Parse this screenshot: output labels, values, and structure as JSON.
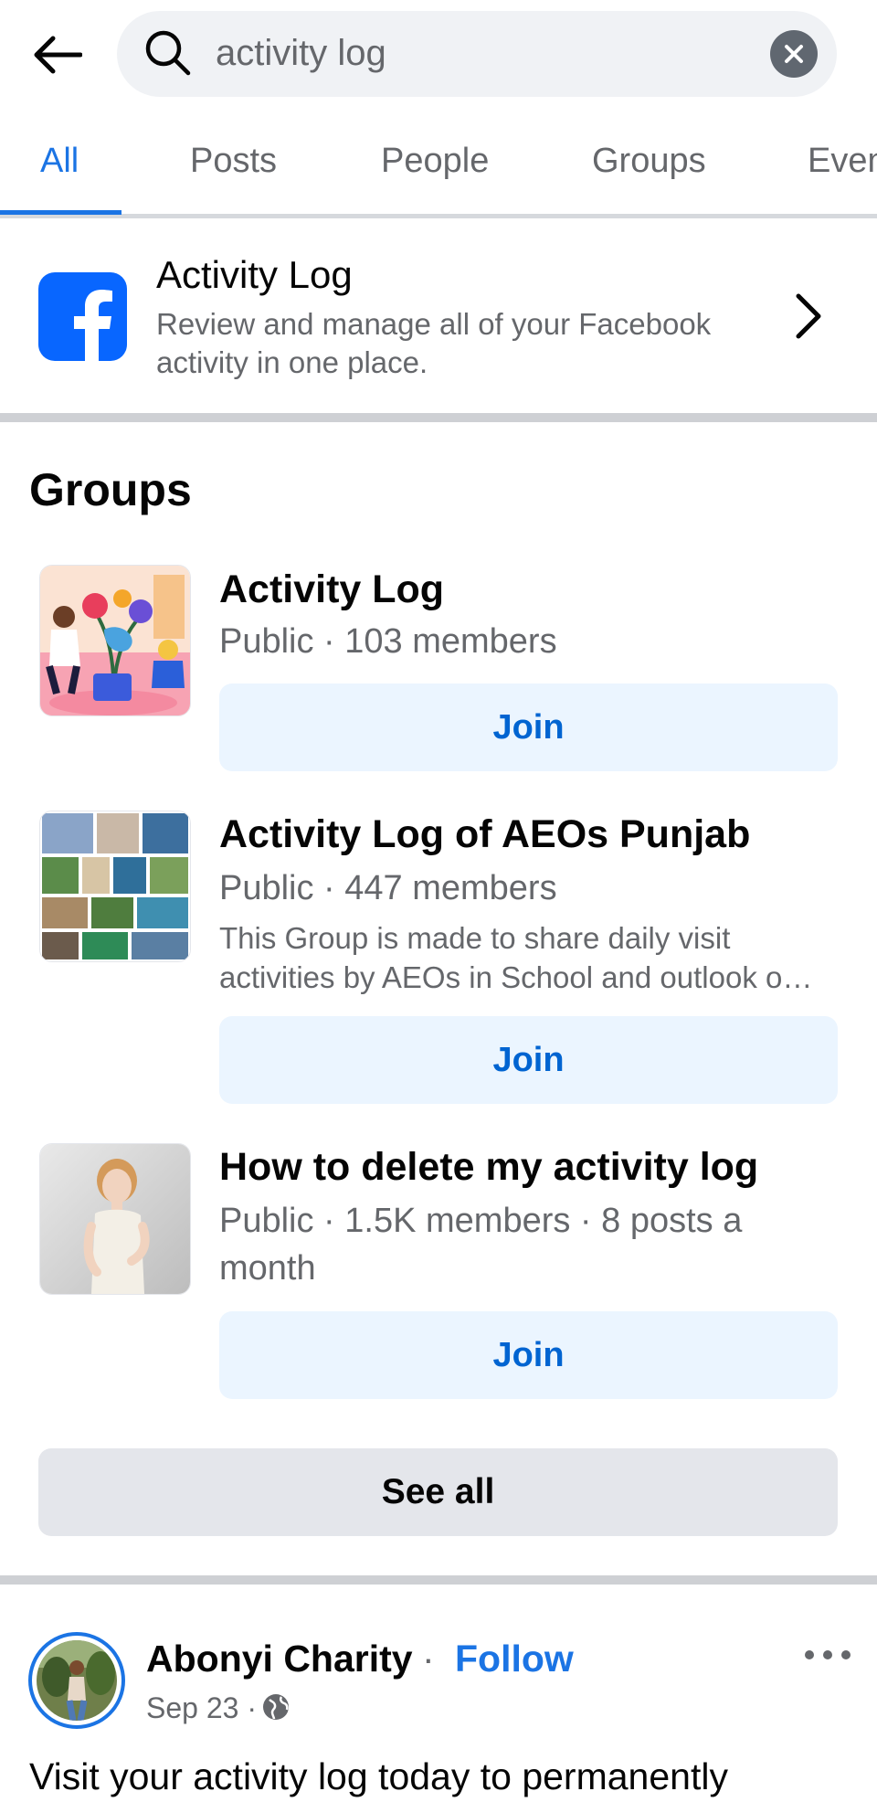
{
  "search": {
    "query": "activity log"
  },
  "tabs": [
    {
      "label": "All",
      "active": true
    },
    {
      "label": "Posts"
    },
    {
      "label": "People"
    },
    {
      "label": "Groups"
    },
    {
      "label": "Even"
    }
  ],
  "activity_card": {
    "title": "Activity Log",
    "description": "Review and manage all of your Facebook activity in one place.",
    "icon": "facebook-logo"
  },
  "groups": {
    "heading": "Groups",
    "items": [
      {
        "title": "Activity Log",
        "meta": "Public · 103 members",
        "join_label": "Join"
      },
      {
        "title": "Activity Log of AEOs Punjab",
        "meta": "Public · 447 members",
        "description": "This Group is made to share daily visit activities by AEOs in School and outlook o…",
        "join_label": "Join"
      },
      {
        "title": "How to delete my activity log",
        "meta": "Public · 1.5K members · 8 posts a month",
        "join_label": "Join"
      }
    ],
    "see_all_label": "See all"
  },
  "post": {
    "author": "Abonyi Charity",
    "separator": "·",
    "follow_label": "Follow",
    "date": "Sep 23 ·",
    "privacy_icon": "globe-icon",
    "text": "Visit your activity log today to permanently"
  },
  "colors": {
    "accent": "#1b74e4",
    "join_bg": "#ebf5ff",
    "join_text": "#0064d1",
    "facebook_blue": "#0866ff"
  }
}
